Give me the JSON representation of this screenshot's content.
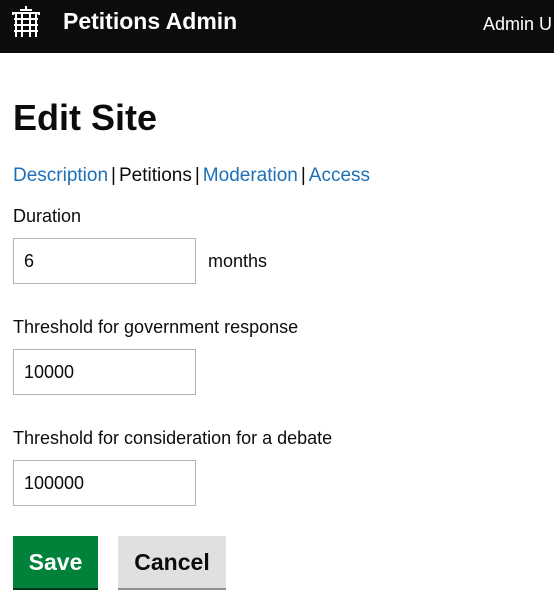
{
  "header": {
    "app_title": "Petitions Admin",
    "admin_user": "Admin U",
    "logo_icon": "portcullis-icon"
  },
  "page": {
    "title": "Edit Site"
  },
  "subnav": {
    "items": [
      {
        "label": "Description",
        "active": false
      },
      {
        "label": "Petitions",
        "active": true
      },
      {
        "label": "Moderation",
        "active": false
      },
      {
        "label": "Access",
        "active": false
      }
    ],
    "separator": "|"
  },
  "form": {
    "duration": {
      "label": "Duration",
      "value": "6",
      "suffix": "months"
    },
    "threshold_response": {
      "label": "Threshold for government response",
      "value": "10000"
    },
    "threshold_debate": {
      "label": "Threshold for consideration for a debate",
      "value": "100000"
    }
  },
  "actions": {
    "save_label": "Save",
    "cancel_label": "Cancel"
  },
  "colors": {
    "header_bg": "#0b0c0c",
    "link": "#1d70b8",
    "save_bg": "#00823b",
    "cancel_bg": "#dee0e2"
  }
}
